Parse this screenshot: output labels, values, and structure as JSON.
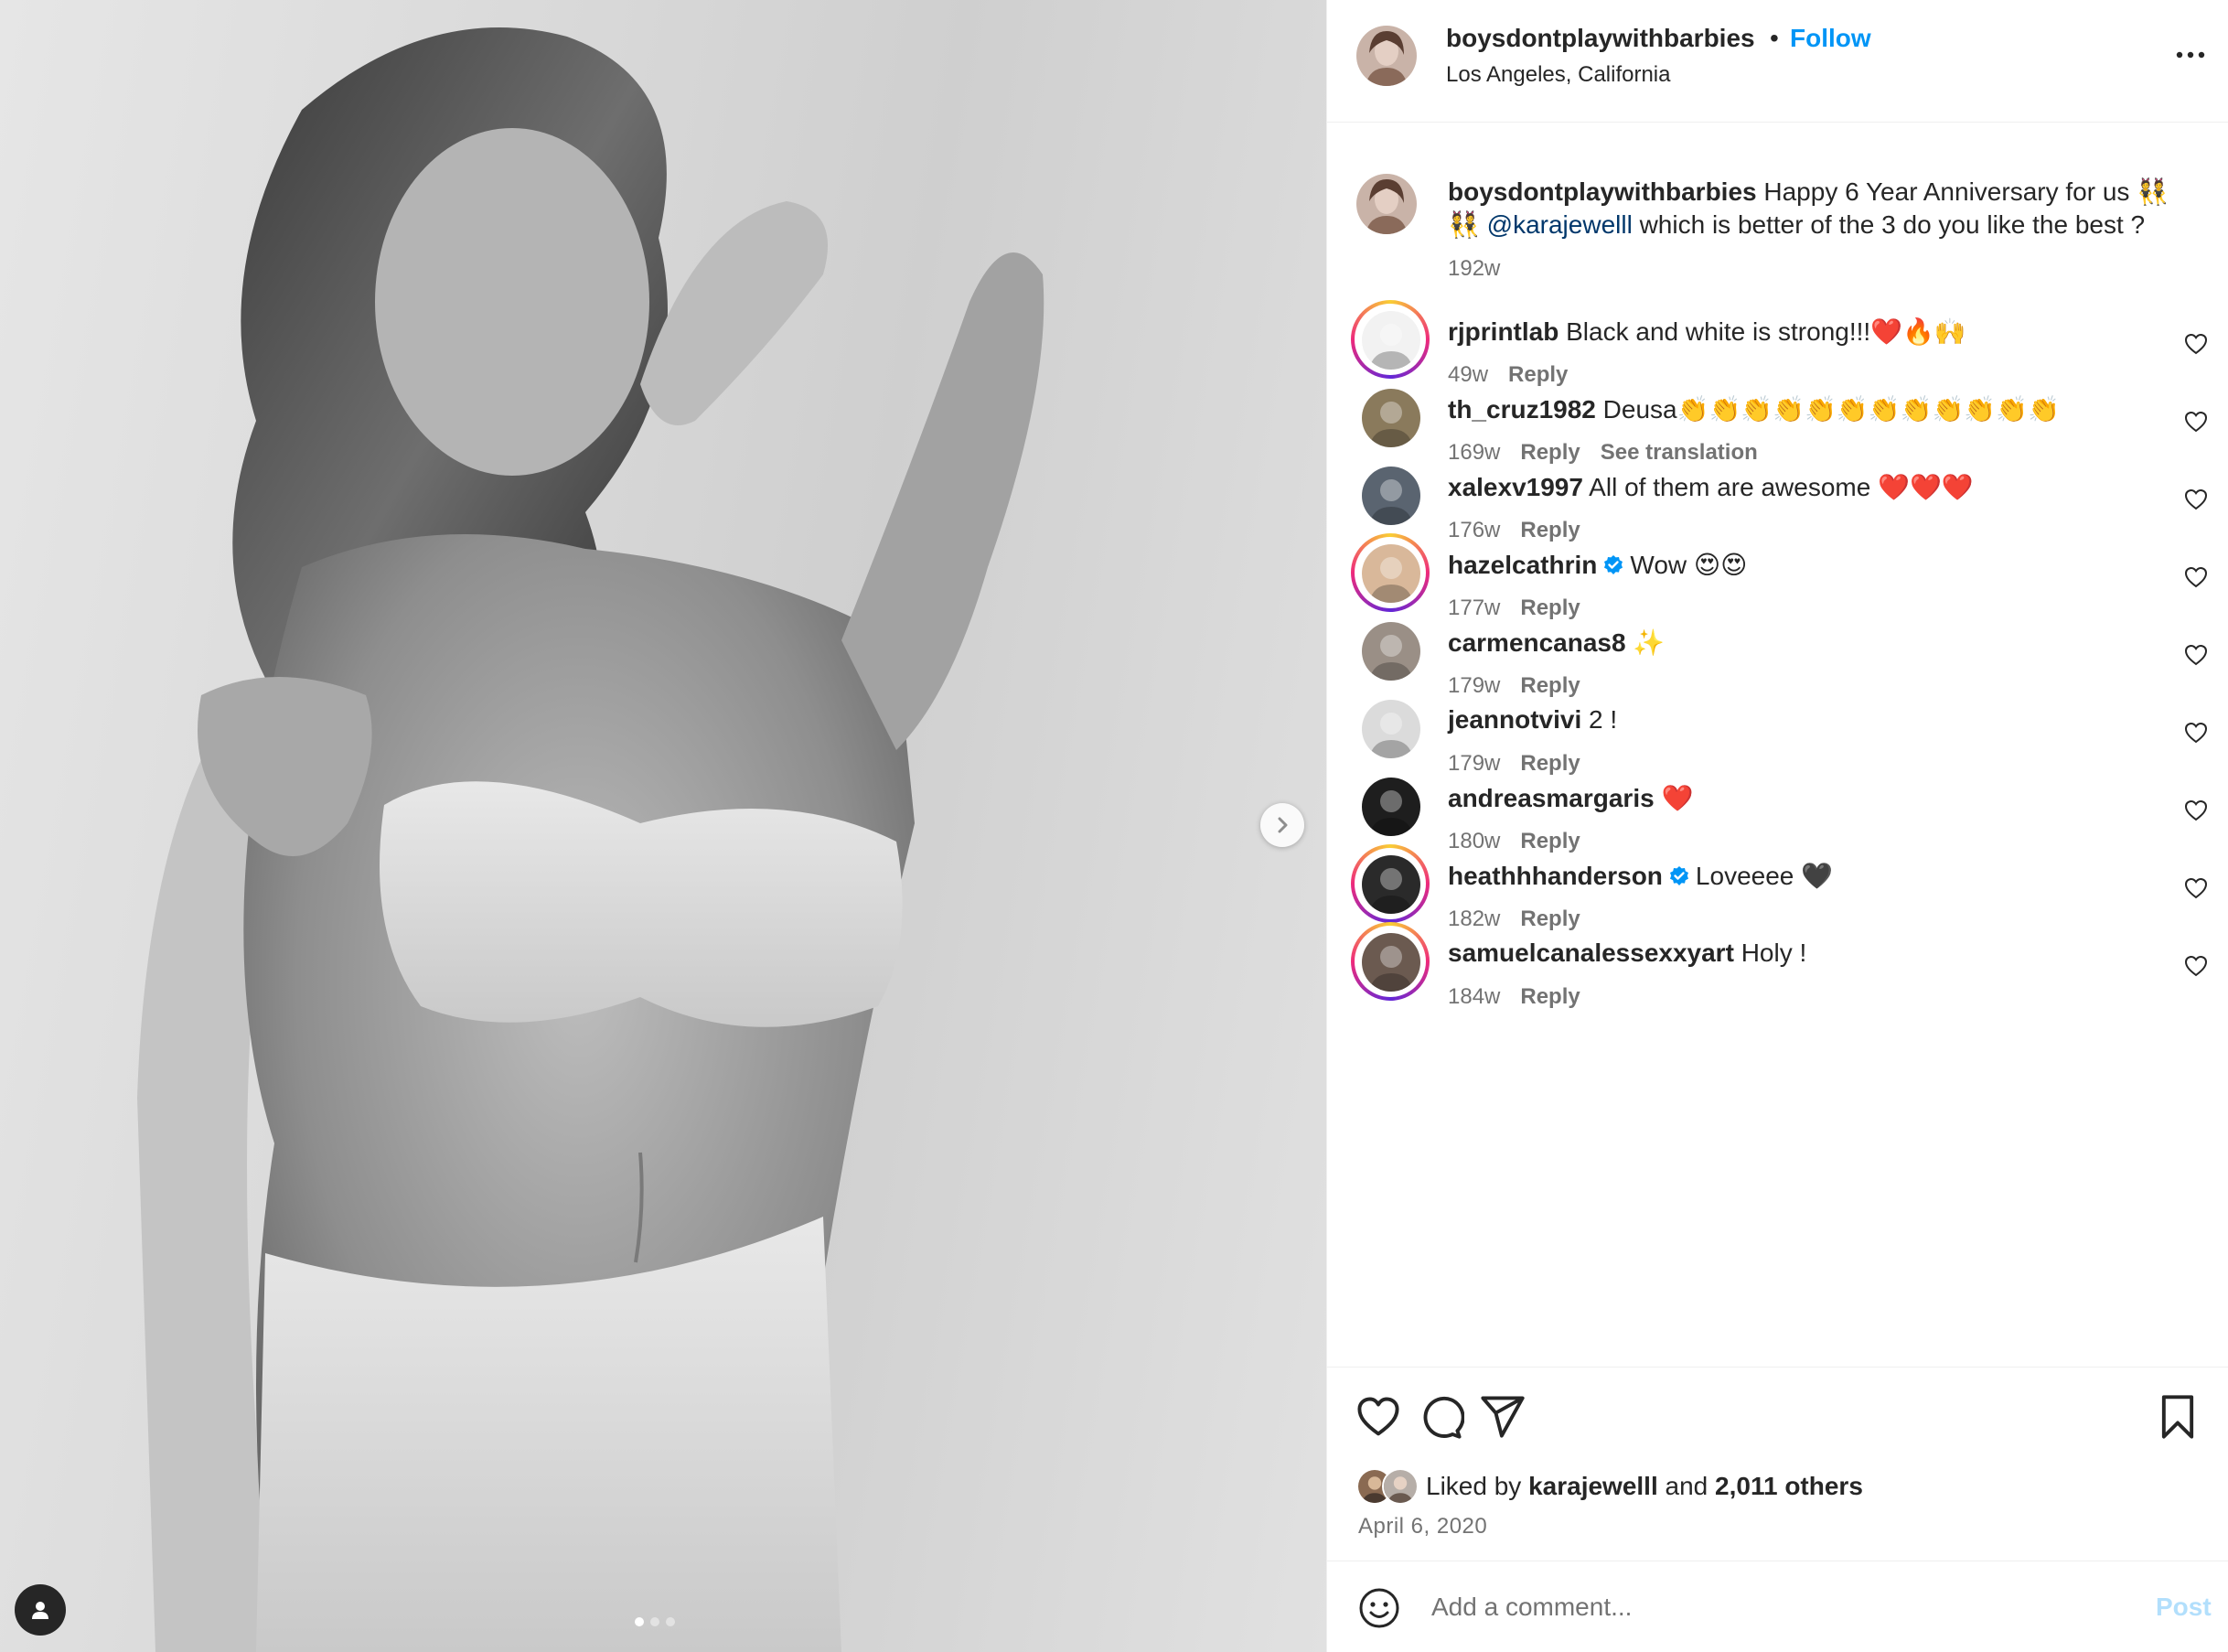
{
  "media": {
    "photo_icon": "photo-portrait",
    "next_icon": "chevron-right-icon",
    "tag_icon": "user-tag-icon",
    "carousel_total": 3,
    "carousel_active": 1
  },
  "header": {
    "username": "boysdontplaywithbarbies",
    "separator": "•",
    "follow_label": "Follow",
    "location": "Los Angeles, California"
  },
  "caption": {
    "username": "boysdontplaywithbarbies",
    "text_before": " Happy 6 Year Anniversary for us 👯 👯 ",
    "mention": "@karajewelll",
    "text_after": " which is better of the 3 do you like the best ?",
    "time": "192w"
  },
  "comments": [
    {
      "username": "rjprintlab",
      "verified": false,
      "text": "Black and white is strong!!!❤️🔥🙌",
      "time": "49w",
      "reply": "Reply",
      "extra": "",
      "ring": true,
      "avatar_color": "#f2f2f2"
    },
    {
      "username": "th_cruz1982",
      "verified": false,
      "text": "Deusa👏👏👏👏👏👏👏👏👏👏👏👏",
      "time": "169w",
      "reply": "Reply",
      "extra": "See translation",
      "ring": false,
      "avatar_color": "#8a7a5c"
    },
    {
      "username": "xalexv1997",
      "verified": false,
      "text": "All of them are awesome ❤️❤️❤️",
      "time": "176w",
      "reply": "Reply",
      "extra": "",
      "ring": false,
      "avatar_color": "#5a6470"
    },
    {
      "username": "hazelcathrin",
      "verified": true,
      "text": "Wow 😍😍",
      "time": "177w",
      "reply": "Reply",
      "extra": "",
      "ring": true,
      "avatar_color": "#d9b89a"
    },
    {
      "username": "carmencanas8",
      "verified": false,
      "text": "✨",
      "time": "179w",
      "reply": "Reply",
      "extra": "",
      "ring": false,
      "avatar_color": "#9a8f86"
    },
    {
      "username": "jeannotvivi",
      "verified": false,
      "text": "2 !",
      "time": "179w",
      "reply": "Reply",
      "extra": "",
      "ring": false,
      "avatar_color": "#dbdbdb"
    },
    {
      "username": "andreasmargaris",
      "verified": false,
      "text": "❤️",
      "time": "180w",
      "reply": "Reply",
      "extra": "",
      "ring": false,
      "avatar_color": "#1e1e1e"
    },
    {
      "username": "heathhhanderson",
      "verified": true,
      "text": "Loveeee 🖤",
      "time": "182w",
      "reply": "Reply",
      "extra": "",
      "ring": true,
      "avatar_color": "#2a2a2a"
    },
    {
      "username": "samuelcanalessexxyart",
      "verified": false,
      "text": "Holy !",
      "time": "184w",
      "reply": "Reply",
      "extra": "",
      "ring": true,
      "avatar_color": "#6b5a50"
    }
  ],
  "actions": {
    "like_icon": "heart-icon",
    "comment_icon": "comment-bubble-icon",
    "share_icon": "paper-plane-icon",
    "save_icon": "bookmark-icon"
  },
  "likes": {
    "prefix": "Liked by ",
    "user": "karajewelll",
    "middle": " and ",
    "others": "2,011 others"
  },
  "date": "April 6, 2020",
  "composer": {
    "placeholder": "Add a comment...",
    "post_label": "Post",
    "emoji_icon": "smiley-icon"
  },
  "colors": {
    "accent": "#0095f6",
    "mention": "#00376b",
    "secondary_text": "#737373",
    "post_disabled": "#b2dffc",
    "verified": "#0095f6"
  }
}
